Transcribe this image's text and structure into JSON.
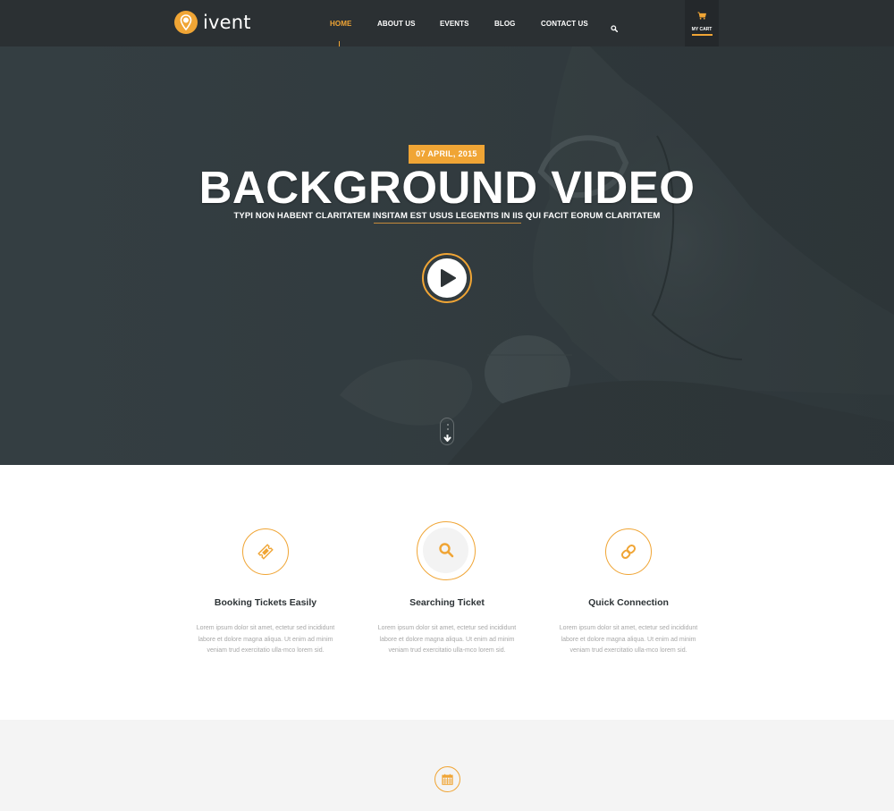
{
  "brand": {
    "name": "ivent",
    "logo_icon": "map-pin-icon",
    "accent_color": "#f0a535",
    "header_bg": "#2b3033"
  },
  "nav": {
    "items": [
      {
        "label": "HOME",
        "active": true
      },
      {
        "label": "ABOUT US",
        "active": false
      },
      {
        "label": "EVENTS",
        "active": false
      },
      {
        "label": "BLOG",
        "active": false
      },
      {
        "label": "CONTACT US",
        "active": false
      }
    ],
    "search_icon": "search-icon",
    "cart": {
      "label": "MY CART",
      "icon": "shopping-cart-icon"
    }
  },
  "hero": {
    "date": "07 APRIL, 2015",
    "title": "BACKGROUND VIDEO",
    "subtitle": "TYPI NON HABENT CLARITATEM INSITAM EST USUS LEGENTIS IN IIS QUI FACIT EORUM CLARITATEM",
    "play_icon": "play-icon",
    "scroll_icon": "scroll-down-icon"
  },
  "features": [
    {
      "icon": "ticket-icon",
      "title": "Booking Tickets Easily",
      "text": "Lorem ipsum dolor sit amet, ectetur sed incididunt labore et dolore magna aliqua. Ut enim ad minim veniam trud exercitatio ulla-mco lorem sid."
    },
    {
      "icon": "search-icon",
      "title": "Searching Ticket",
      "text": "Lorem ipsum dolor sit amet, ectetur sed incididunt labore et dolore magna aliqua. Ut enim ad minim veniam trud exercitatio ulla-mco lorem sid."
    },
    {
      "icon": "link-icon",
      "title": "Quick Connection",
      "text": "Lorem ipsum dolor sit amet, ectetur sed incididunt labore et dolore magna aliqua. Ut enim ad minim veniam trud exercitatio ulla-mco lorem sid."
    }
  ],
  "events_section": {
    "icon": "calendar-icon"
  }
}
